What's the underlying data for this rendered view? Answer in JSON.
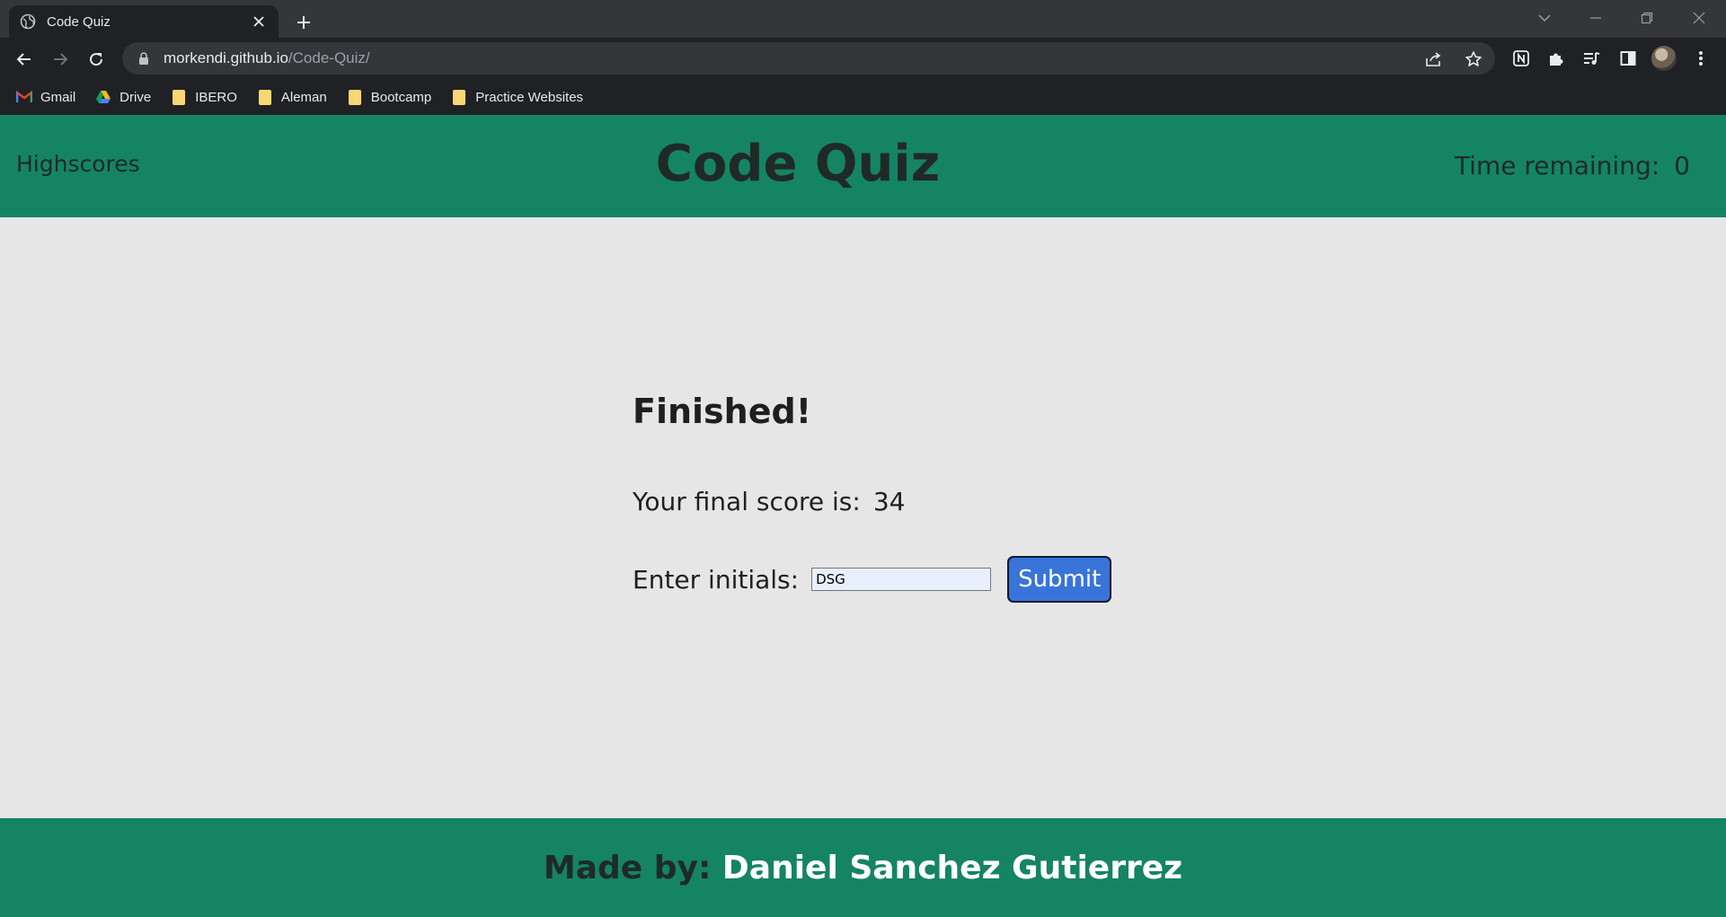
{
  "browser": {
    "tab_title": "Code Quiz",
    "url_host": "morkendi.github.io",
    "url_path": "/Code-Quiz/",
    "bookmarks": [
      {
        "label": "Gmail",
        "icon": "gmail-icon"
      },
      {
        "label": "Drive",
        "icon": "drive-icon"
      },
      {
        "label": "IBERO",
        "icon": "folder-icon"
      },
      {
        "label": "Aleman",
        "icon": "folder-icon"
      },
      {
        "label": "Bootcamp",
        "icon": "folder-icon"
      },
      {
        "label": "Practice Websites",
        "icon": "folder-icon"
      }
    ]
  },
  "header": {
    "highscores_link": "Highscores",
    "title": "Code Quiz",
    "time_label": "Time remaining:",
    "time_value": "0"
  },
  "result": {
    "heading": "Finished!",
    "score_label": "Your final score is:",
    "score_value": "34",
    "initials_label": "Enter initials:",
    "initials_value": "DSG",
    "submit_label": "Submit"
  },
  "footer": {
    "made_by": "Made by:",
    "author": "Daniel Sanchez Gutierrez"
  },
  "colors": {
    "header_bg": "#158463",
    "page_bg": "#e6e6e6",
    "submit_bg": "#3974d8"
  }
}
